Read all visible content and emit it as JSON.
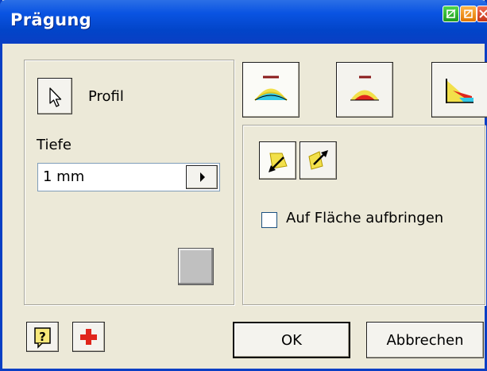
{
  "window": {
    "title": "Prägung",
    "title_buttons": [
      "minimize-icon",
      "help-icon",
      "close-icon"
    ]
  },
  "left_panel": {
    "profile_button_icon": "cursor-arrow-icon",
    "profile_label": "Profil",
    "depth_label": "Tiefe",
    "depth_value": "1 mm",
    "depth_dropdown_icon": "triangle-right-icon"
  },
  "right_panel": {
    "mode_buttons": [
      "emboss-from-face-icon",
      "engrave-from-face-icon",
      "emboss-engrave-from-plane-icon"
    ],
    "direction_buttons": [
      "direction-flip-down-icon",
      "direction-flip-up-icon"
    ],
    "wrap_checkbox_label": "Auf Fläche aufbringen",
    "wrap_checkbox_checked": false
  },
  "footer": {
    "help_icon": "help-question-icon",
    "add_icon": "red-plus-icon",
    "ok_label": "OK",
    "cancel_label": "Abbrechen"
  },
  "colors": {
    "titlebar": "#0a54e2",
    "dialog_bg": "#ece9d8"
  }
}
